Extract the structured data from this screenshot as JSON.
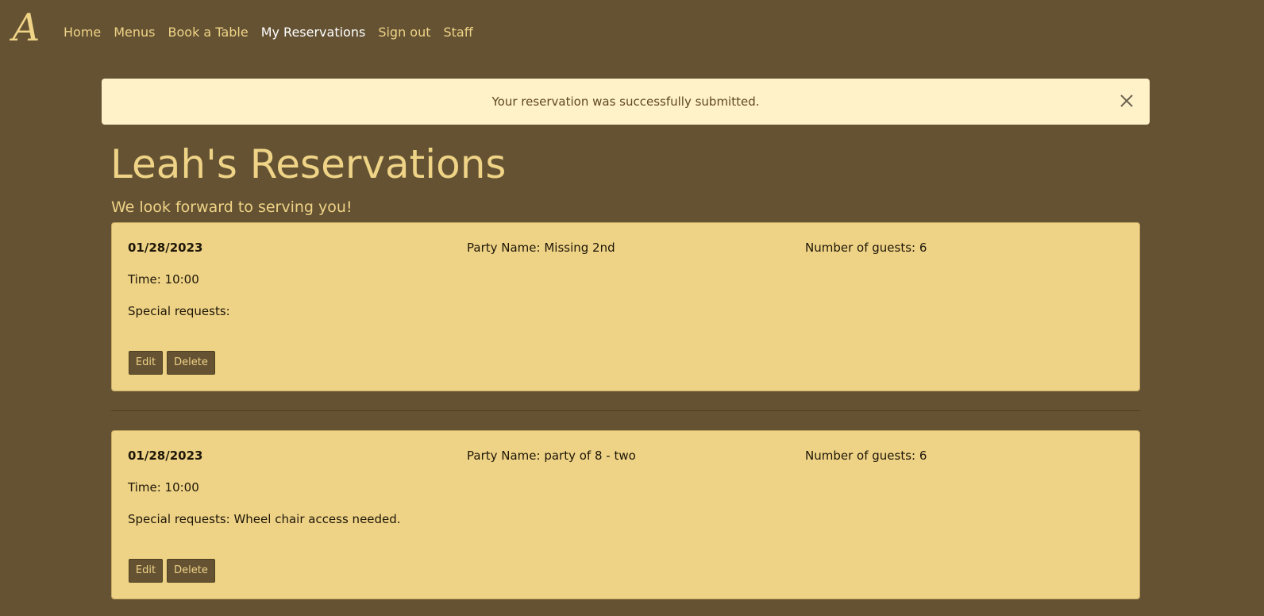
{
  "nav": {
    "brand": "A",
    "items": [
      {
        "label": "Home",
        "active": false
      },
      {
        "label": "Menus",
        "active": false
      },
      {
        "label": "Book a Table",
        "active": false
      },
      {
        "label": "My Reservations",
        "active": true
      },
      {
        "label": "Sign out",
        "active": false
      },
      {
        "label": "Staff",
        "active": false
      }
    ]
  },
  "alert": {
    "message": "Your reservation was successfully submitted.",
    "close_icon": "close-icon"
  },
  "page": {
    "title": "Leah's Reservations",
    "subtitle": "We look forward to serving you!"
  },
  "reservations": [
    {
      "date": "01/28/2023",
      "party": "Party Name: Missing 2nd",
      "guests": "Number of guests: 6",
      "time": "Time: 10:00",
      "requests": "Special requests:",
      "edit_label": "Edit",
      "delete_label": "Delete"
    },
    {
      "date": "01/28/2023",
      "party": "Party Name: party of 8 - two",
      "guests": "Number of guests: 6",
      "time": "Time: 10:00",
      "requests": "Special requests: Wheel chair access needed.",
      "edit_label": "Edit",
      "delete_label": "Delete"
    }
  ],
  "colors": {
    "background": "#645233",
    "accent": "#efd386",
    "card": "#eed386",
    "alert": "#fff1c8"
  }
}
